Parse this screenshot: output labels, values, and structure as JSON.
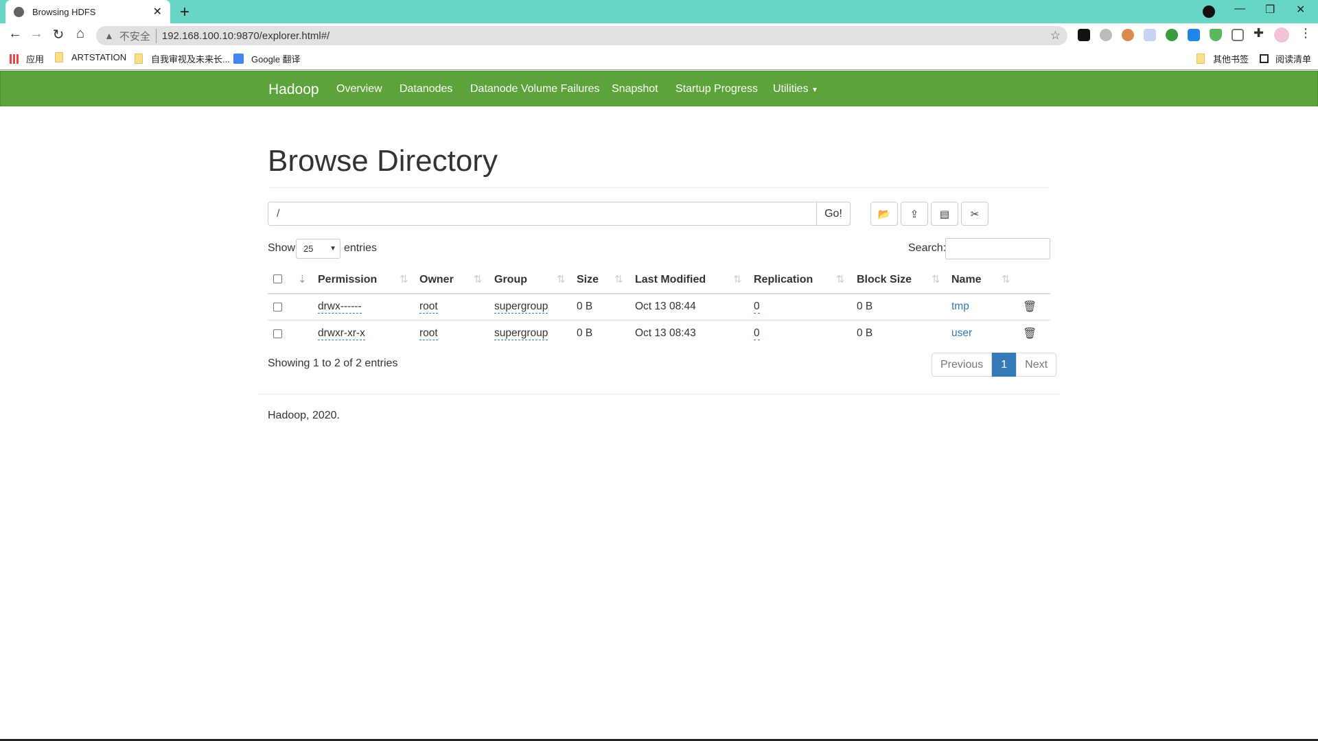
{
  "browser": {
    "tab_title": "Browsing HDFS",
    "url_insecure": "不安全",
    "url": "192.168.100.10:9870/explorer.html#/",
    "bookmarks": [
      {
        "label": "应用",
        "icon": "apps-grid-icon"
      },
      {
        "label": "ARTSTATION",
        "icon": "folder-icon"
      },
      {
        "label": "自我审视及未来长...",
        "icon": "folder-icon"
      },
      {
        "label": "Google 翻译",
        "icon": "google-translate-icon"
      }
    ],
    "other_bookmarks": "其他书签",
    "reading_list": "阅读清单"
  },
  "navbar": {
    "brand": "Hadoop",
    "items": [
      "Overview",
      "Datanodes",
      "Datanode Volume Failures",
      "Snapshot",
      "Startup Progress",
      "Utilities"
    ],
    "color": "#5ca43a"
  },
  "page": {
    "title": "Browse Directory",
    "path_value": "/",
    "go_label": "Go!",
    "tool_buttons": [
      "create-directory-icon",
      "upload-icon",
      "cut-icon",
      "paste-icon"
    ],
    "show_label": "Show",
    "entries_value": "25",
    "entries_label": "entries",
    "search_label": "Search:",
    "columns": [
      "Permission",
      "Owner",
      "Group",
      "Size",
      "Last Modified",
      "Replication",
      "Block Size",
      "Name"
    ],
    "rows": [
      {
        "permission": "drwx------",
        "owner": "root",
        "group": "supergroup",
        "size": "0 B",
        "modified": "Oct 13 08:44",
        "replication": "0",
        "block_size": "0 B",
        "name": "tmp"
      },
      {
        "permission": "drwxr-xr-x",
        "owner": "root",
        "group": "supergroup",
        "size": "0 B",
        "modified": "Oct 13 08:43",
        "replication": "0",
        "block_size": "0 B",
        "name": "user"
      }
    ],
    "summary": "Showing 1 to 2 of 2 entries",
    "pager": {
      "previous": "Previous",
      "current": "1",
      "next": "Next"
    },
    "footer": "Hadoop, 2020."
  }
}
